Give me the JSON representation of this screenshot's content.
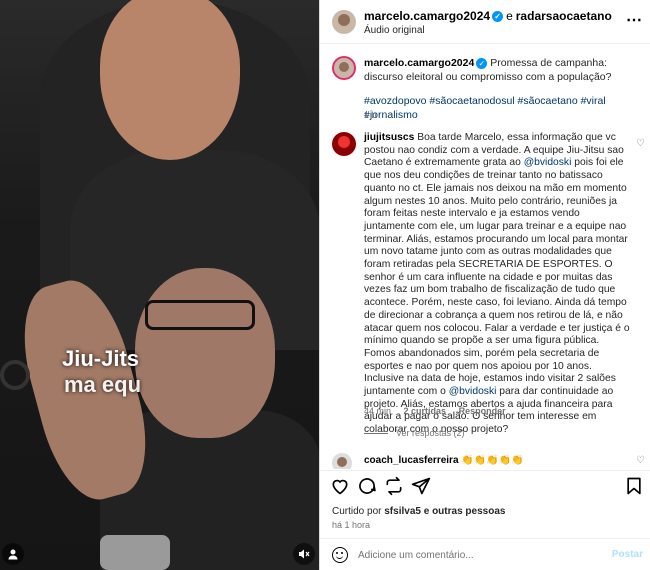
{
  "media": {
    "subtitle_line1": "Jiu-Jits",
    "subtitle_line2": "ma equ"
  },
  "header": {
    "username": "marcelo.camargo2024",
    "separator": "e",
    "collaborator": "radarsaocaetano",
    "audio": "Áudio original"
  },
  "caption": {
    "username": "marcelo.camargo2024",
    "text": "Promessa de campanha: discurso eleitoral ou compromisso com a população?",
    "hashtags": "#avozdopovo #sãocaetanodosul #sãocaetano #viral #jornalismo",
    "time": "1 h"
  },
  "comment": {
    "username": "jiujitsuscs",
    "text_part1": "Boa tarde Marcelo, essa informação que vc postou nao condiz com a verdade. A equipe Jiu-Jitsu sao Caetano é extremamente grata ao",
    "mention1": "@bvidoski",
    "text_part2": "pois foi ele que nos deu condições de treinar tanto no batissaco quanto no ct. Ele jamais nos deixou na mão em momento algum nestes 10 anos. Muito pelo contrário, reuniões ja foram feitas neste intervalo e ja estamos vendo juntamente com ele, um lugar para treinar e a equipe nao terminar. Aliás, estamos procurando um local para montar um novo tatame junto com as outras modalidades que foram retiradas pela SECRETARIA DE ESPORTES. O senhor é um cara influente na cidade e por muitas das vezes faz um bom trabalho de fiscalização de tudo que acontece. Porém, neste caso, foi leviano. Ainda dá tempo de direcionar a cobrança a quem nos retirou de lá, e não atacar quem nos colocou. Falar a verdade e ter justiça é o mínimo quando se propõe a ser uma figura pública. Fomos abandonados sim, porém pela secretaria de esportes e nao por quem nos apoiou por 10 anos. Inclusive na data de hoje, estamos indo visitar 2 salões juntamente com o",
    "mention2": "@bvidoski",
    "text_part3": "para dar continuidade ao projeto. Aliás, estamos abertos a ajuda financeira para ajudar a pagar o salão. O senhor tem interesse em colaborar com o nosso projeto?",
    "time": "44 min",
    "likes": "2 curtidas",
    "reply": "Responder",
    "view_replies": "Ver respostas (2)"
  },
  "comment2": {
    "username": "coach_lucasferreira",
    "text": "👏👏👏👏👏"
  },
  "likes": {
    "prefix": "Curtido por",
    "user": "sfsilva5",
    "suffix": "e outras pessoas",
    "time": "há 1 hora"
  },
  "add_comment": {
    "placeholder": "Adicione um comentário...",
    "post": "Postar"
  },
  "colors": {
    "accent": "#0095f6",
    "link": "#00376b",
    "muted": "#737373"
  }
}
